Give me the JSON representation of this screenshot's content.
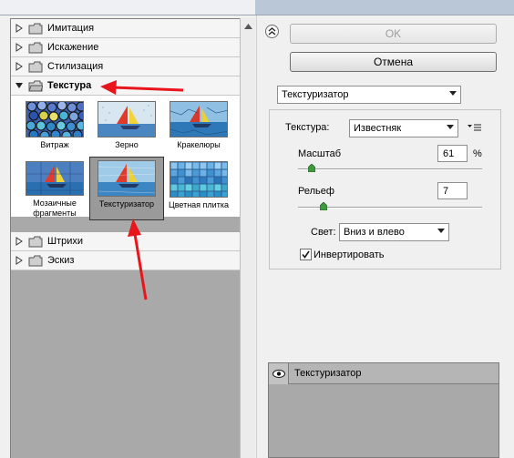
{
  "filter_categories": [
    {
      "label": "Имитация",
      "expanded": false
    },
    {
      "label": "Искажение",
      "expanded": false
    },
    {
      "label": "Стилизация",
      "expanded": false
    },
    {
      "label": "Текстура",
      "expanded": true
    },
    {
      "label": "Штрихи",
      "expanded": false
    },
    {
      "label": "Эскиз",
      "expanded": false
    }
  ],
  "texture_filters": [
    {
      "label": "Витраж",
      "selected": false,
      "icon": "stained-glass-thumbnail"
    },
    {
      "label": "Зерно",
      "selected": false,
      "icon": "grain-thumbnail"
    },
    {
      "label": "Кракелюры",
      "selected": false,
      "icon": "craquelure-thumbnail"
    },
    {
      "label": "Мозаичные фрагменты",
      "selected": false,
      "icon": "mosaic-tiles-thumbnail"
    },
    {
      "label": "Текстуризатор",
      "selected": true,
      "icon": "texturizer-thumbnail"
    },
    {
      "label": "Цветная плитка",
      "selected": false,
      "icon": "patchwork-thumbnail"
    }
  ],
  "buttons": {
    "ok": "OK",
    "cancel": "Отмена"
  },
  "filter_select": {
    "value": "Текстуризатор"
  },
  "params": {
    "texture_label": "Текстура:",
    "texture_value": "Известняк",
    "scale_label": "Масштаб",
    "scale_value": "61",
    "scale_unit": "%",
    "scale_level": 61,
    "relief_label": "Рельеф",
    "relief_value": "7",
    "relief_level": 7,
    "light_label": "Свет:",
    "light_value": "Вниз и влево",
    "invert_label": "Инвертировать",
    "invert_checked": true
  },
  "layer": {
    "name": "Текстуризатор",
    "visible": true
  },
  "colors": {
    "annotation_arrow": "#e8161c",
    "panel_gray": "#a9a9a9"
  }
}
